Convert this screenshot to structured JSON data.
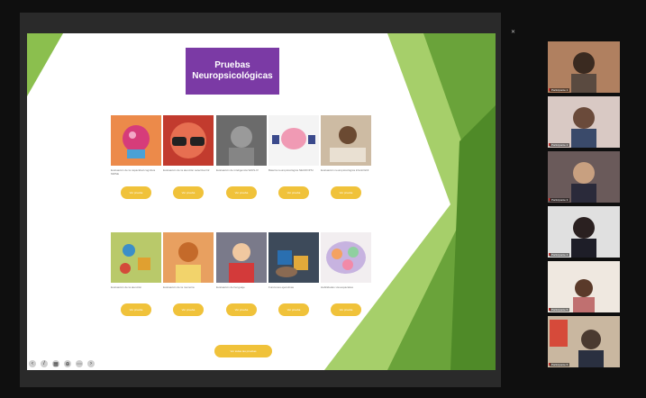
{
  "slide": {
    "title_line1": "Pruebas",
    "title_line2": "Neuropsicológicas",
    "row1": [
      {
        "caption": "Evaluación de la capacidad cognitiva MMSE",
        "button": "Ver prueba"
      },
      {
        "caption": "Evaluación de la atención selectiva D2",
        "button": "Ver prueba"
      },
      {
        "caption": "Evaluación de inteligencia WAIS-IV",
        "button": "Ver prueba"
      },
      {
        "caption": "Batería neuropsicológica NEUROPSI",
        "button": "Ver prueba"
      },
      {
        "caption": "Evaluación neuropsicológica infantil ENI",
        "button": "Ver prueba"
      }
    ],
    "row2": [
      {
        "caption": "Evaluación de la atención",
        "button": "Ver prueba"
      },
      {
        "caption": "Evaluación de la memoria",
        "button": "Ver prueba"
      },
      {
        "caption": "Evaluación del lenguaje",
        "button": "Ver prueba"
      },
      {
        "caption": "Funciones ejecutivas",
        "button": "Ver prueba"
      },
      {
        "caption": "Habilidades visoespaciales",
        "button": "Ver prueba"
      }
    ],
    "bottom_button": "Ver todas las pruebas"
  },
  "participants": [
    {
      "name": "Participante 1"
    },
    {
      "name": "Participante 2"
    },
    {
      "name": "Participante 3"
    },
    {
      "name": "Participante 4"
    },
    {
      "name": "Participante 5"
    },
    {
      "name": "Participante 6"
    }
  ],
  "colors": {
    "title_bg": "#7b3aa5",
    "button": "#f0c23a",
    "green_dark": "#6aa33a",
    "green_light": "#a6cf6a"
  }
}
